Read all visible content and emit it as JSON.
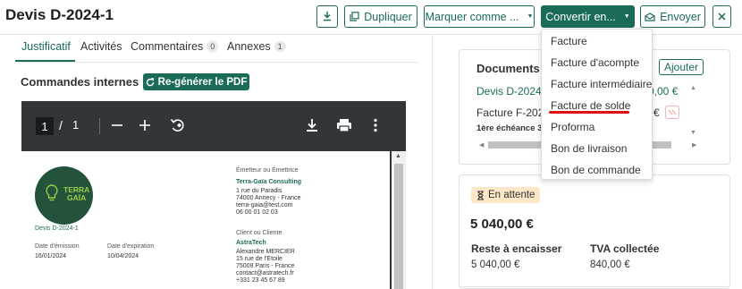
{
  "header": {
    "title": "Devis D-2024-1",
    "download_icon": "download-icon",
    "duplicate_label": "Dupliquer",
    "mark_as_label": "Marquer comme ...",
    "convert_label": "Convertir en...",
    "send_label": "Envoyer",
    "close_icon": "close-icon"
  },
  "tabs": [
    {
      "label": "Justificatif",
      "active": true
    },
    {
      "label": "Activités"
    },
    {
      "label": "Commentaires",
      "count": "0"
    },
    {
      "label": "Annexes",
      "count": "1"
    }
  ],
  "commands": {
    "label": "Commandes internes :",
    "regen_label": "Re-générer le PDF"
  },
  "viewer": {
    "page_current": "1",
    "page_separator": "/",
    "page_total": "1"
  },
  "pdf": {
    "logo_line1": "TERRA",
    "logo_line2": "GAÏA",
    "doc_ref": "Devis D-2024-1",
    "issue_label": "Date d'émission",
    "issue_date": "16/01/2024",
    "expiry_label": "Date d'expiration",
    "expiry_date": "10/04/2024",
    "issuer_label": "Émetteur ou Émettrice",
    "issuer_name": "Terra-Gaïa Consulting",
    "issuer_address1": "1 rue du Paradis",
    "issuer_address2": "74000 Annecy - France",
    "issuer_email": "terra-gaia@test.com",
    "issuer_phone": "06 00 01 02 03",
    "client_label": "Client ou Cliente",
    "client_name": "AstraTech",
    "client_contact": "Alexandre MERCIER",
    "client_address1": "15 rue de l'Etoile",
    "client_address2": "75008 Paris - France",
    "client_email": "contact@astratech.fr",
    "client_phone": "+331 23 45 67 89"
  },
  "documents": {
    "title": "Documents li",
    "add_label": "Ajouter",
    "row1_link": "Devis D-2024-",
    "row1_amount": "0,00 €",
    "row2_name": "Facture F-2024",
    "row2_amount": "€",
    "row2_due": "1ère échéance 30"
  },
  "status": {
    "badge": "En attente",
    "amount": "5 040,00 €",
    "remaining_label": "Reste à encaisser",
    "remaining_value": "5 040,00 €",
    "vat_label": "TVA collectée",
    "vat_value": "840,00 €"
  },
  "convert_menu": {
    "items": [
      "Facture",
      "Facture d'acompte",
      "Facture intermédiaire",
      "Facture de solde",
      "Proforma",
      "Bon de livraison",
      "Bon de commande"
    ],
    "highlighted": "Facture de solde",
    "underline_color": "#dd1111"
  },
  "colors": {
    "accent": "#1b6b59",
    "pending_bg": "#fde7c6",
    "viewer_bg": "#323639"
  }
}
